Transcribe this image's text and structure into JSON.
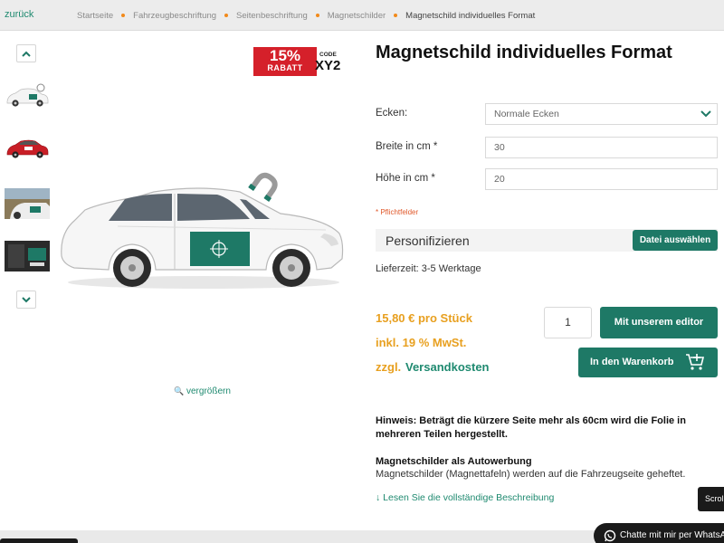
{
  "nav": {
    "back_label": "zurück",
    "breadcrumbs": [
      "Startseite",
      "Fahrzeugbeschriftung",
      "Seitenbeschriftung",
      "Magnetschilder",
      "Magnetschild individuelles Format"
    ]
  },
  "gallery": {
    "thumbnails": [
      "car-front-magnet-thumb",
      "red-car-thumb",
      "car-detail-thumb",
      "car-dark-thumb"
    ],
    "zoom_label": "vergrößern"
  },
  "promo": {
    "percent": "15%",
    "label": "RABATT",
    "code_label": "CODE",
    "code": "XY2"
  },
  "product": {
    "title": "Magnetschild individuelles Format",
    "fields": {
      "corners": {
        "label": "Ecken:",
        "value": "Normale Ecken"
      },
      "width": {
        "label": "Breite in cm *",
        "value": "30"
      },
      "height": {
        "label": "Höhe in cm *",
        "value": "20"
      }
    },
    "required_note": "* Pflichtfelder",
    "personalize_label": "Personifizieren",
    "file_button": "Datei auswählen",
    "delivery": "Lieferzeit: 3-5 Werktage",
    "price": "15,80 € pro Stück",
    "tax": "inkl. 19 % MwSt.",
    "shipping_prefix": "zzgl.",
    "shipping_link": "Versandkosten",
    "quantity": "1",
    "editor_button": "Mit unserem editor",
    "cart_button": "In den Warenkorb",
    "hint": "Hinweis: Beträgt die kürzere Seite mehr als 60cm wird die Folie in mehreren Teilen hergestellt.",
    "section_title": "Magnetschilder als Autowerbung",
    "section_text": "Magnetschilder (Magnettafeln) werden auf die Fahrzeugseite geheftet.",
    "read_more": "Lesen Sie die vollständige Beschreibung"
  },
  "widgets": {
    "scroll_label": "Scroll",
    "chat_label": "Chatte mit mir per WhatsApp"
  },
  "colors": {
    "accent": "#1e7966",
    "price": "#e8a020",
    "promo": "#d5202a",
    "breadcrumb_dot": "#f28a1a"
  }
}
